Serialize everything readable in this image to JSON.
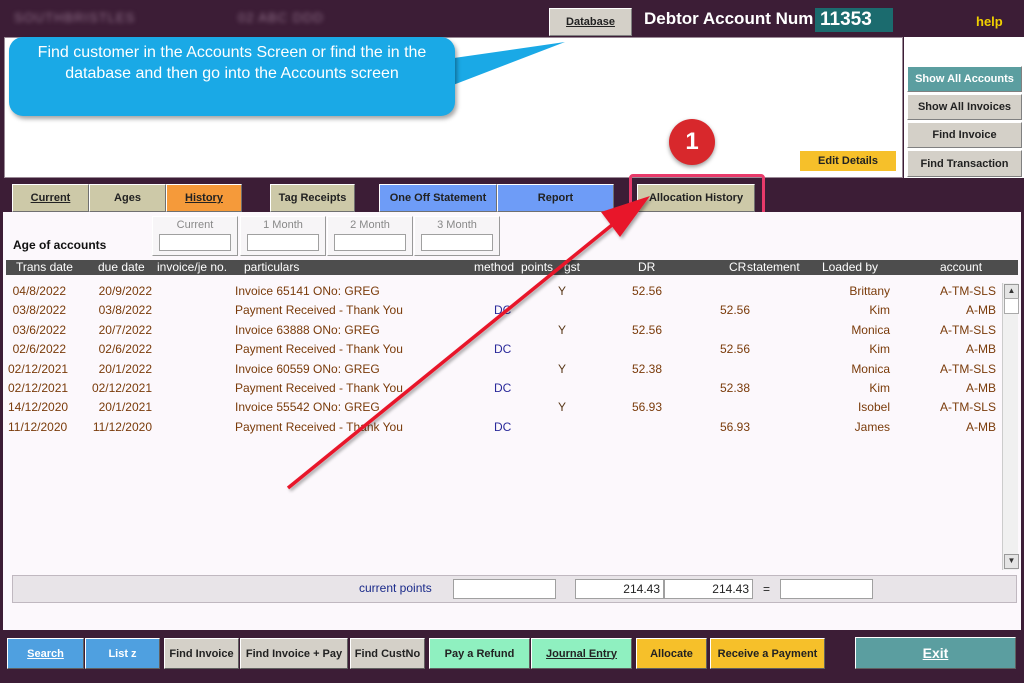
{
  "header": {
    "blurred_left": "SOUTHBRISTLES",
    "blurred_mid": "02 ABC DDD",
    "database_label": "Database",
    "debtor_label": "Debtor Account Num:",
    "debtor_num": "11353",
    "help_label": "help"
  },
  "callout_text": "Find customer in the Accounts Screen or find the in the database and then go into the Accounts screen",
  "badge_text": "1",
  "edit_details_label": "Edit Details",
  "side_buttons": {
    "show_all_accounts": "Show All Accounts",
    "show_all_invoices": "Show All Invoices",
    "find_invoice": "Find Invoice",
    "find_transaction": "Find Transaction"
  },
  "tabs": {
    "current": "Current",
    "ages": "Ages",
    "history": "History",
    "tag_receipts": "Tag Receipts",
    "one_off_statement": "One Off Statement",
    "report": "Report",
    "allocation_history": "Allocation History"
  },
  "age": {
    "title": "Age of accounts",
    "labels": [
      "Current",
      "1 Month",
      "2 Month",
      "3 Month"
    ]
  },
  "columns": [
    "Trans date",
    "due date",
    "invoice/je no.",
    "particulars",
    "method",
    "points",
    "gst",
    "DR",
    "CR",
    "statement",
    "Loaded by",
    "account"
  ],
  "rows": [
    {
      "trans": "04/8/2022",
      "due": "20/9/2022",
      "part": "Invoice 65141 ONo: GREG",
      "method": "",
      "gst": "Y",
      "dr": "52.56",
      "cr": "",
      "by": "Brittany",
      "acct": "A-TM-SLS"
    },
    {
      "trans": "03/8/2022",
      "due": "03/8/2022",
      "part": "Payment Received - Thank You",
      "method": "DC",
      "gst": "",
      "dr": "",
      "cr": "52.56",
      "by": "Kim",
      "acct": "A-MB"
    },
    {
      "trans": "03/6/2022",
      "due": "20/7/2022",
      "part": "Invoice 63888 ONo: GREG",
      "method": "",
      "gst": "Y",
      "dr": "52.56",
      "cr": "",
      "by": "Monica",
      "acct": "A-TM-SLS"
    },
    {
      "trans": "02/6/2022",
      "due": "02/6/2022",
      "part": "Payment Received - Thank You",
      "method": "DC",
      "gst": "",
      "dr": "",
      "cr": "52.56",
      "by": "Kim",
      "acct": "A-MB"
    },
    {
      "trans": "02/12/2021",
      "due": "20/1/2022",
      "part": "Invoice 60559 ONo: GREG",
      "method": "",
      "gst": "Y",
      "dr": "52.38",
      "cr": "",
      "by": "Monica",
      "acct": "A-TM-SLS"
    },
    {
      "trans": "02/12/2021",
      "due": "02/12/2021",
      "part": "Payment Received - Thank You",
      "method": "DC",
      "gst": "",
      "dr": "",
      "cr": "52.38",
      "by": "Kim",
      "acct": "A-MB"
    },
    {
      "trans": "14/12/2020",
      "due": "20/1/2021",
      "part": "Invoice 55542 ONo: GREG",
      "method": "",
      "gst": "Y",
      "dr": "56.93",
      "cr": "",
      "by": "Isobel",
      "acct": "A-TM-SLS"
    },
    {
      "trans": "11/12/2020",
      "due": "11/12/2020",
      "part": "Payment Received - Thank You",
      "method": "DC",
      "gst": "",
      "dr": "",
      "cr": "56.93",
      "by": "James",
      "acct": "A-MB"
    }
  ],
  "points": {
    "label": "current points",
    "dr_total": "214.43",
    "cr_total": "214.43",
    "equals": "="
  },
  "bottom_buttons": {
    "search": "Search",
    "list": "List z",
    "find_invoice": "Find Invoice",
    "find_invoice_pay": "Find Invoice + Pay",
    "find_custno": "Find CustNo",
    "pay_refund": "Pay a Refund",
    "journal_entry": "Journal Entry",
    "allocate": "Allocate",
    "receive_payment": "Receive a Payment",
    "exit": "Exit"
  },
  "colors": {
    "background": "#3c1d36",
    "callout": "#1aa9e6",
    "arrow": "#e8192c",
    "badge": "#d8282c"
  }
}
